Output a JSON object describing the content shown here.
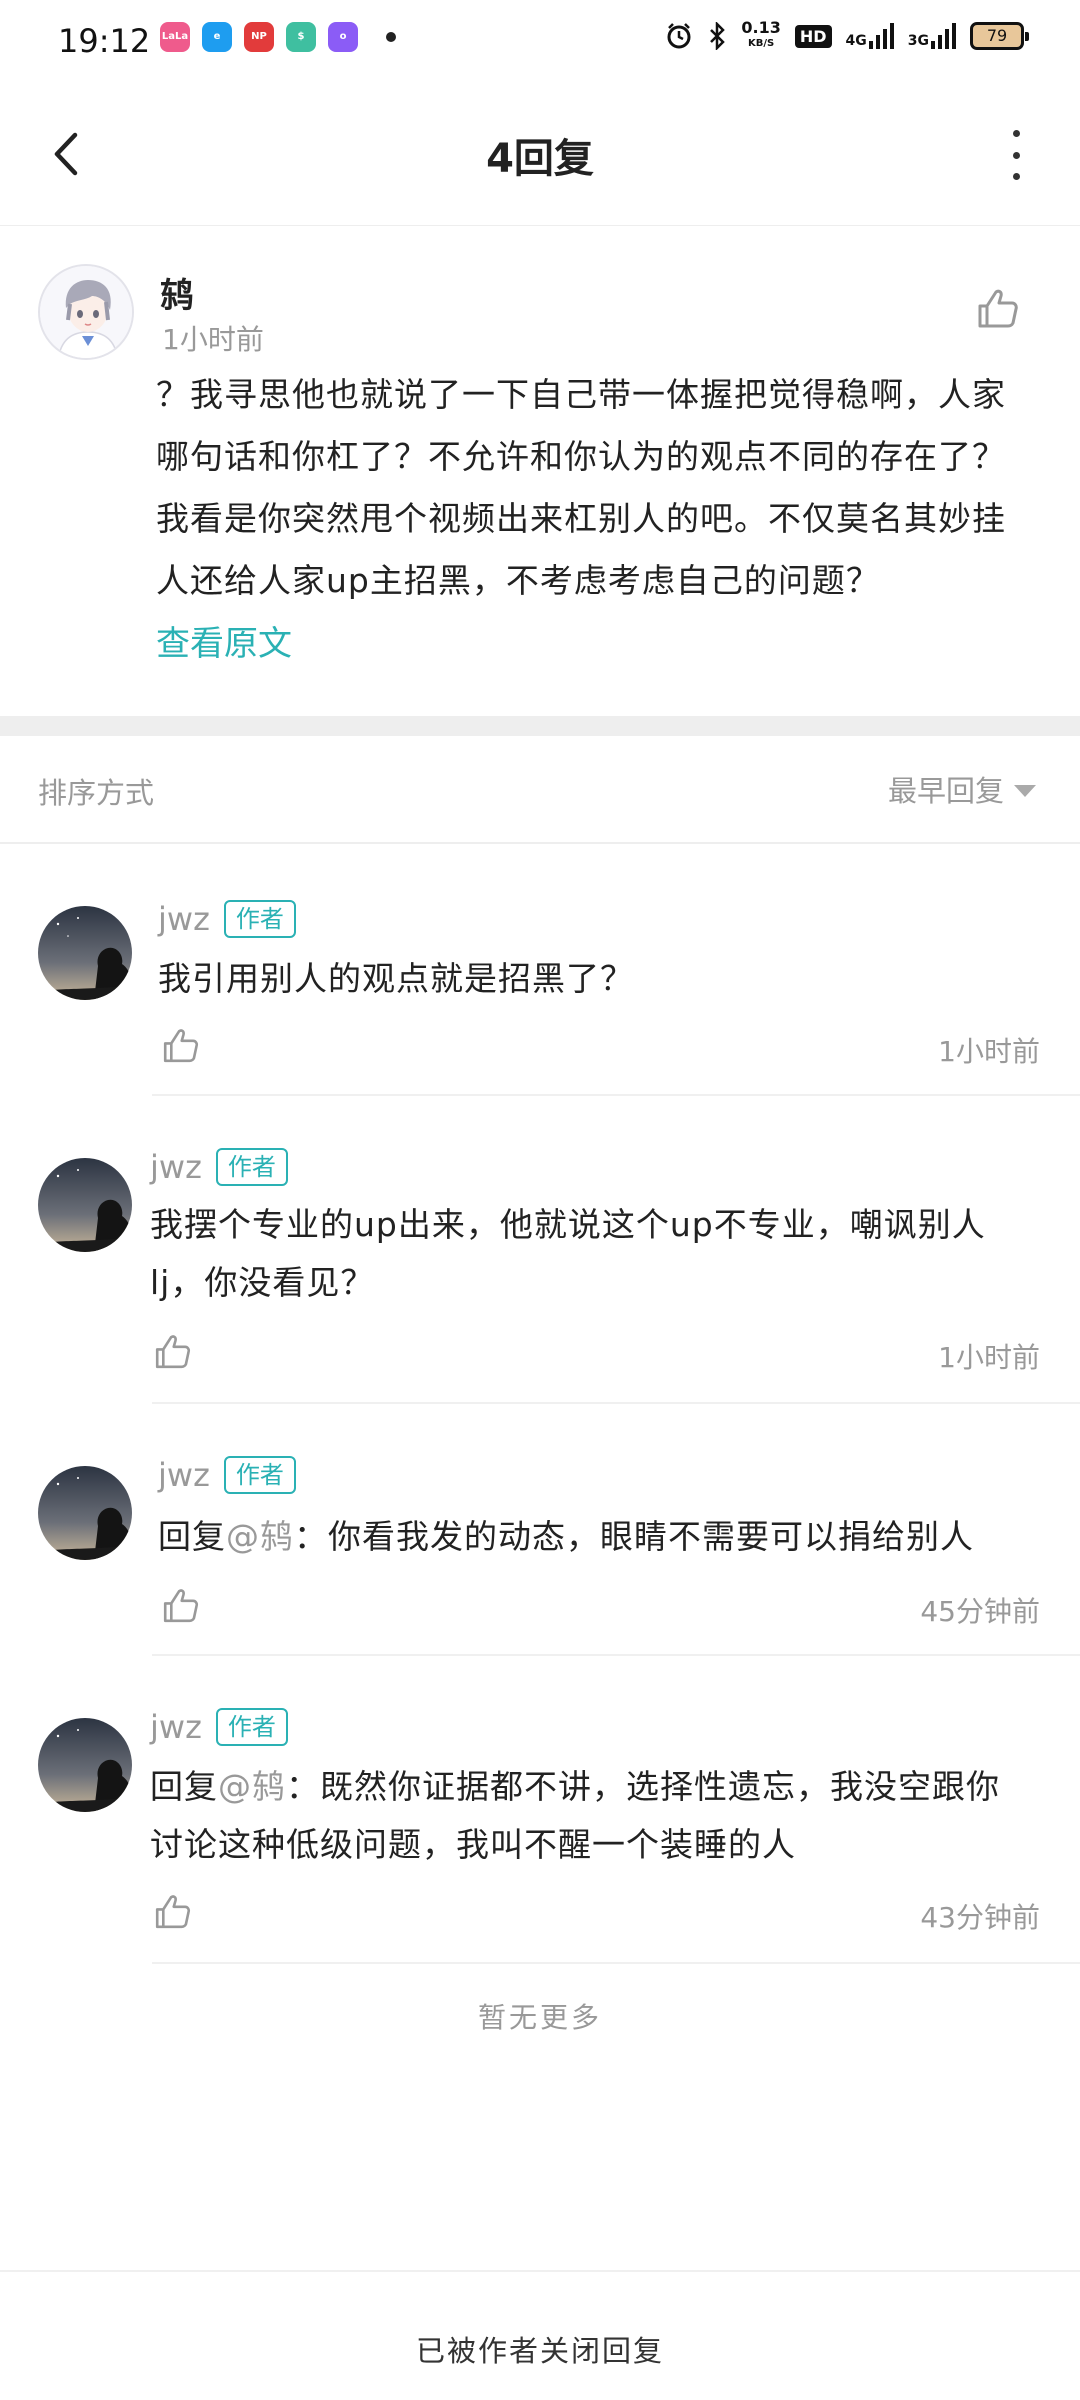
{
  "status_bar": {
    "time": "19:12",
    "apps": [
      {
        "label": "LaLa",
        "color": "#ef5b8c"
      },
      {
        "label": "e",
        "color": "#1e9df0"
      },
      {
        "label": "NP",
        "color": "#e23b3b"
      },
      {
        "label": "$",
        "color": "#3fbfa0"
      },
      {
        "label": "o",
        "color": "#8b5cf6"
      }
    ],
    "speed_value": "0.13",
    "speed_unit": "KB/S",
    "hd_label": "HD",
    "sig1_label": "4G",
    "sig2_label": "3G",
    "battery": "79"
  },
  "nav": {
    "title": "4回复"
  },
  "main_comment": {
    "author": "鸫",
    "time": "1小时前",
    "text": "？我寻思他也就说了一下自己带一体握把觉得稳啊，人家哪句话和你杠了？不允许和你认为的观点不同的存在了？我看是你突然甩个视频出来杠别人的吧。不仅莫名其妙挂人还给人家up主招黑，不考虑考虑自己的问题？",
    "view_original": "查看原文"
  },
  "sort": {
    "label": "排序方式",
    "value": "最早回复"
  },
  "replies": [
    {
      "name": "jwz",
      "badge": "作者",
      "text": "我引用别人的观点就是招黑了？",
      "time": "1小时前"
    },
    {
      "name": "jwz",
      "badge": "作者",
      "text": "我摆个专业的up出来，他就说这个up不专业，嘲讽别人lj，你没看见？",
      "time": "1小时前"
    },
    {
      "name": "jwz",
      "badge": "作者",
      "prefix": "回复",
      "mention": "@鸫",
      "text": "：你看我发的动态，眼睛不需要可以捐给别人",
      "time": "45分钟前"
    },
    {
      "name": "jwz",
      "badge": "作者",
      "prefix": "回复",
      "mention": "@鸫",
      "text": "：既然你证据都不讲，选择性遗忘，我没空跟你讨论这种低级问题，我叫不醒一个装睡的人",
      "time": "43分钟前"
    }
  ],
  "no_more": "暂无更多",
  "footer": "已被作者关闭回复"
}
